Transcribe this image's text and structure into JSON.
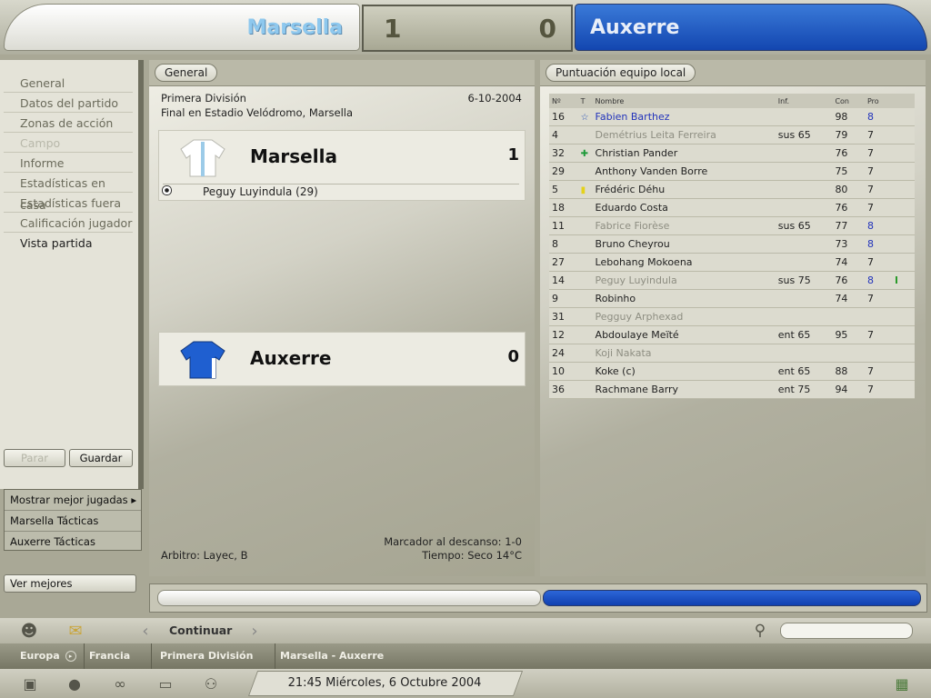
{
  "scoreboard": {
    "home_team": "Marsella",
    "home_score": "1",
    "away_score": "0",
    "away_team": "Auxerre"
  },
  "leftnav": {
    "items": [
      {
        "label": "General",
        "state": "normal"
      },
      {
        "label": "Datos del partido",
        "state": "normal"
      },
      {
        "label": "Zonas de acción",
        "state": "normal"
      },
      {
        "label": "Campo",
        "state": "disabled"
      },
      {
        "label": "Informe",
        "state": "normal"
      },
      {
        "label": "Estadísticas en casa",
        "state": "normal"
      },
      {
        "label": "Estadísticas fuera",
        "state": "normal"
      },
      {
        "label": "Calificación jugador",
        "state": "normal"
      },
      {
        "label": "Vista partida",
        "state": "active"
      }
    ],
    "stop_label": "Parar",
    "save_label": "Guardar",
    "lower_links": [
      "Mostrar mejor jugadas",
      "Marsella Tácticas",
      "Auxerre Tácticas"
    ],
    "best_label": "Ver mejores"
  },
  "center": {
    "tab": "General",
    "competition": "Primera División",
    "date": "6-10-2004",
    "venue": "Final en Estadio Velódromo, Marsella",
    "home_name": "Marsella",
    "home_goals": "1",
    "scorer": "Peguy Luyindula (29)",
    "away_name": "Auxerre",
    "away_goals": "0",
    "halftime": "Marcador al descanso: 1-0",
    "referee": "Arbitro: Layec, B",
    "weather": "Tiempo: Seco 14°C",
    "home_shirt_color": "#ffffff",
    "away_shirt_color": "#1f5fd0"
  },
  "right": {
    "tab": "Puntuación equipo local",
    "headers": [
      "Nº",
      "T",
      "Nombre",
      "Inf.",
      "Con",
      "Pro"
    ],
    "rows": [
      {
        "num": "16",
        "icon": "star-icon",
        "name": "Fabien Barthez",
        "inf": "",
        "con": "98",
        "pro": "8",
        "style": "blue"
      },
      {
        "num": "4",
        "icon": "",
        "name": "Demétrius Leita Ferreira",
        "inf": "sus 65",
        "con": "79",
        "pro": "7",
        "style": "sub"
      },
      {
        "num": "32",
        "icon": "injury-cross-icon",
        "name": "Christian Pander",
        "inf": "",
        "con": "76",
        "pro": "7",
        "style": ""
      },
      {
        "num": "29",
        "icon": "",
        "name": "Anthony Vanden Borre",
        "inf": "",
        "con": "75",
        "pro": "7",
        "style": ""
      },
      {
        "num": "5",
        "icon": "yellow-card-icon",
        "name": "Frédéric Déhu",
        "inf": "",
        "con": "80",
        "pro": "7",
        "style": ""
      },
      {
        "num": "18",
        "icon": "",
        "name": "Eduardo Costa",
        "inf": "",
        "con": "76",
        "pro": "7",
        "style": ""
      },
      {
        "num": "11",
        "icon": "",
        "name": "Fabrice Fiorèse",
        "inf": "sus 65",
        "con": "77",
        "pro": "8",
        "style": "sub"
      },
      {
        "num": "8",
        "icon": "",
        "name": "Bruno Cheyrou",
        "inf": "",
        "con": "73",
        "pro": "8",
        "style": ""
      },
      {
        "num": "27",
        "icon": "",
        "name": "Lebohang Mokoena",
        "inf": "",
        "con": "74",
        "pro": "7",
        "style": ""
      },
      {
        "num": "14",
        "icon": "",
        "name": "Peguy Luyindula",
        "inf": "sus 75",
        "con": "76",
        "pro": "8",
        "style": "sub"
      },
      {
        "num": "9",
        "icon": "",
        "name": "Robinho",
        "inf": "",
        "con": "74",
        "pro": "7",
        "style": ""
      },
      {
        "num": "31",
        "icon": "",
        "name": "Pegguy Arphexad",
        "inf": "",
        "con": "",
        "pro": "",
        "style": "sub"
      },
      {
        "num": "12",
        "icon": "",
        "name": "Abdoulaye Meïté",
        "inf": "ent 65",
        "con": "95",
        "pro": "7",
        "style": ""
      },
      {
        "num": "24",
        "icon": "",
        "name": "Koji Nakata",
        "inf": "",
        "con": "",
        "pro": "",
        "style": "sub"
      },
      {
        "num": "10",
        "icon": "",
        "name": "Koke (c)",
        "inf": "ent 65",
        "con": "88",
        "pro": "7",
        "style": ""
      },
      {
        "num": "36",
        "icon": "",
        "name": "Rachmane Barry",
        "inf": "ent 75",
        "con": "94",
        "pro": "7",
        "style": ""
      }
    ]
  },
  "possession": {
    "home_color": "#f4f4ee",
    "away_color": "#1e55c8"
  },
  "toolbar": {
    "continue_label": "Continuar",
    "search_placeholder": ""
  },
  "breadcrumb": [
    "Europa",
    "Francia",
    "Primera División",
    "Marsella - Auxerre"
  ],
  "status": {
    "datetime": "21:45 Miércoles, 6 Octubre 2004"
  }
}
